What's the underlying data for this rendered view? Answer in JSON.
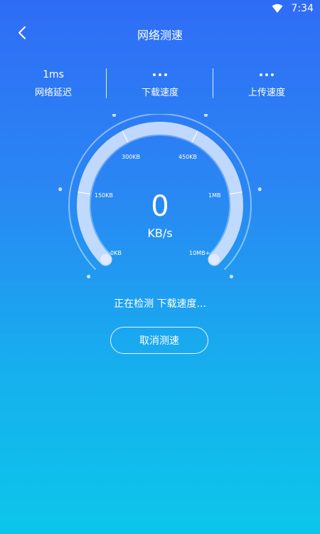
{
  "status_bar": {
    "time": "7:34",
    "wifi_icon": "wifi-icon"
  },
  "app_bar": {
    "title": "网络测速",
    "back_icon": "chevron-left-icon"
  },
  "stats": [
    {
      "value": "1ms",
      "label": "网络延迟"
    },
    {
      "value": "•••",
      "label": "下载速度"
    },
    {
      "value": "•••",
      "label": "上传速度"
    }
  ],
  "gauge": {
    "value": "0",
    "unit": "KB/s",
    "scale_labels": [
      "0KB",
      "150KB",
      "300KB",
      "450KB",
      "1MB",
      "10MB+"
    ],
    "progress_fraction": 0
  },
  "status_text": "正在检测 下载速度...",
  "cancel_button": "取消测速",
  "colors": {
    "bg_top": "#2f6cf6",
    "bg_bottom": "#0cc6ea",
    "foreground": "#ffffff"
  }
}
